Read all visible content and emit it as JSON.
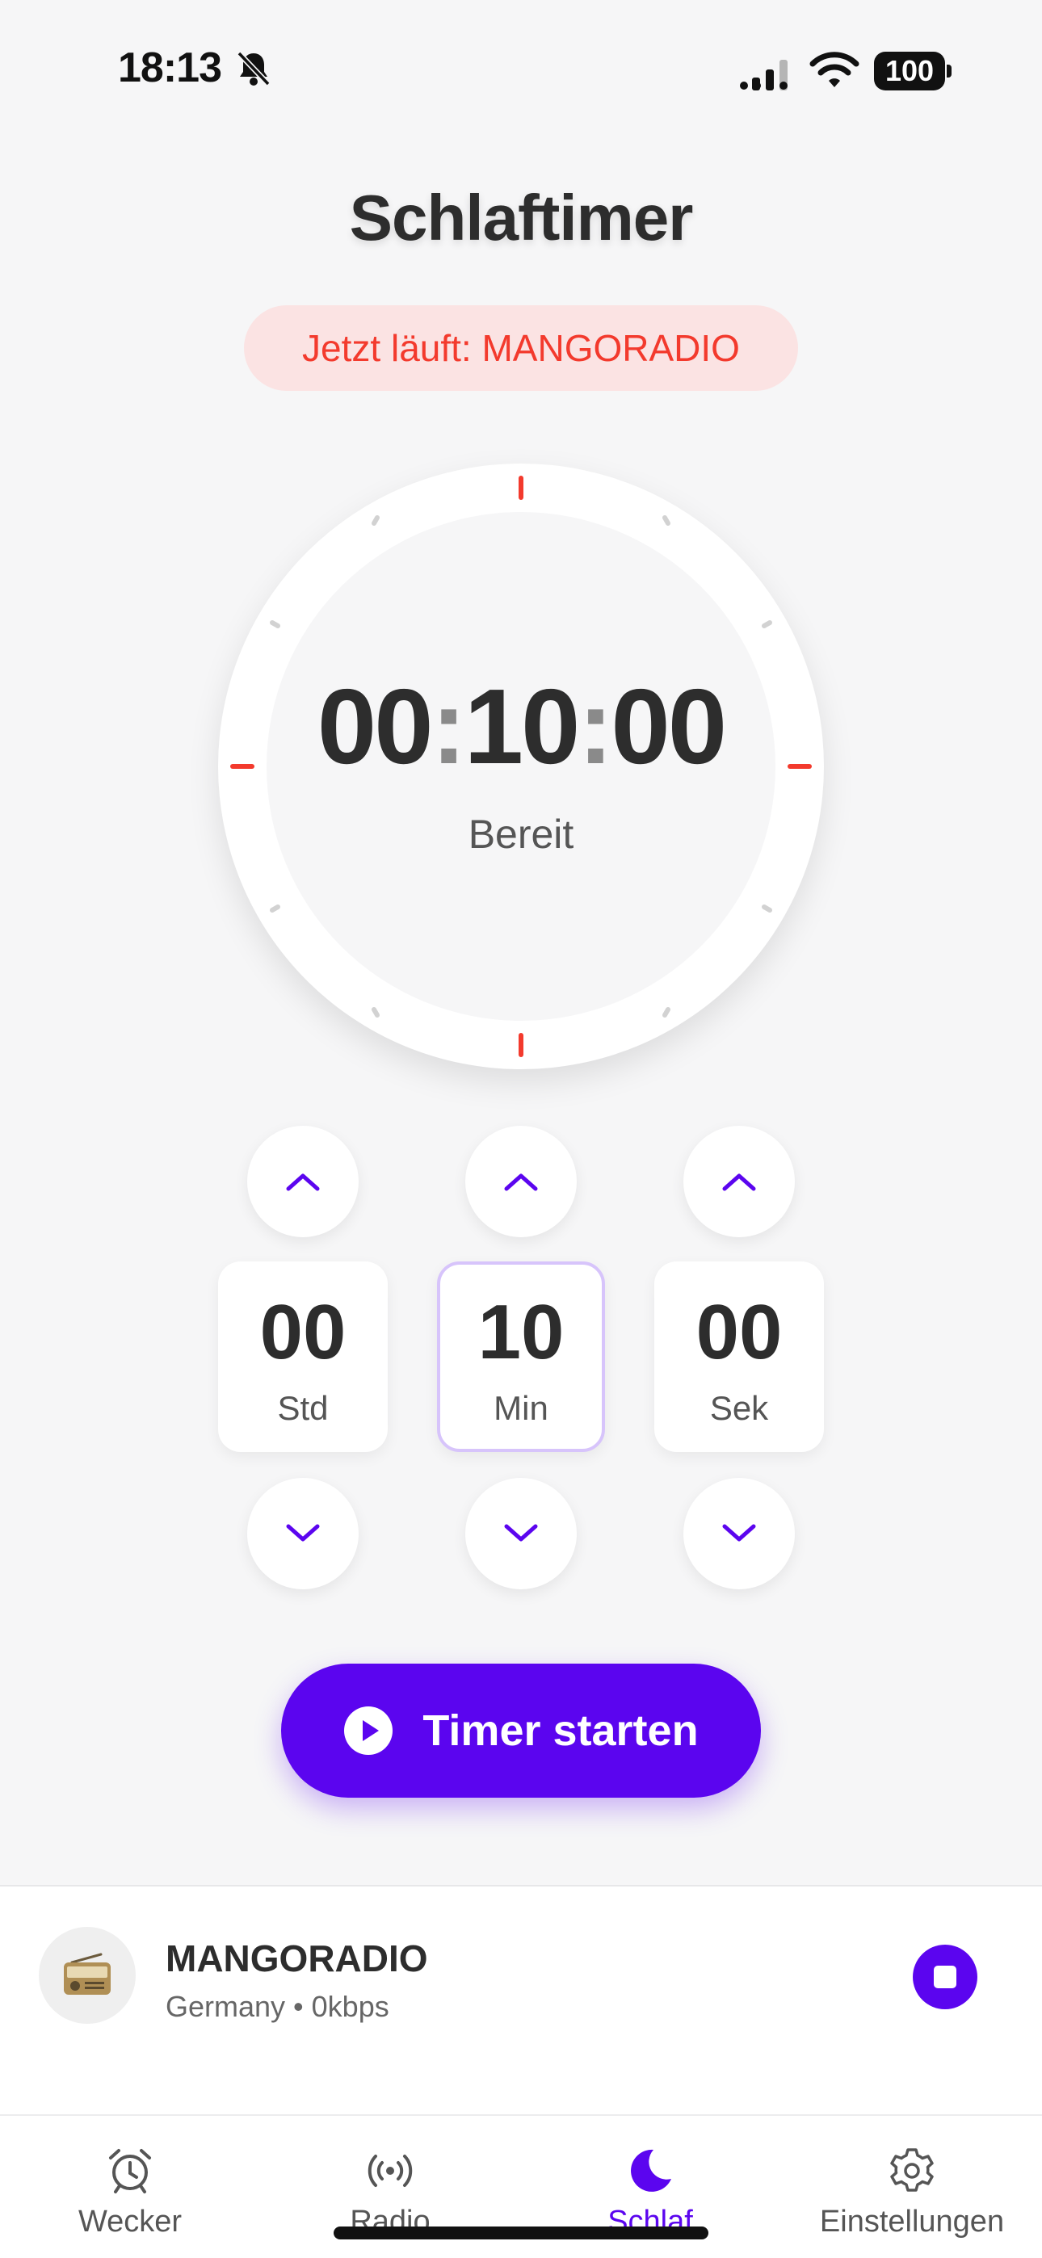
{
  "status_bar": {
    "time": "18:13",
    "battery": "100",
    "icons": [
      "bell-slash-icon",
      "cellular-signal-icon",
      "wifi-icon",
      "battery-icon"
    ]
  },
  "header": {
    "title": "Schlaftimer"
  },
  "now_playing": {
    "text": "Jetzt läuft: MANGORADIO"
  },
  "dial": {
    "hours": "00",
    "minutes": "10",
    "seconds": "00",
    "separator": ":",
    "state": "Bereit"
  },
  "units": [
    {
      "value": "00",
      "label": "Std",
      "selected": false
    },
    {
      "value": "10",
      "label": "Min",
      "selected": true
    },
    {
      "value": "00",
      "label": "Sek",
      "selected": false
    }
  ],
  "start_button": {
    "label": "Timer starten",
    "icon": "play-icon"
  },
  "mini_player": {
    "station": "MANGORADIO",
    "subtitle": "Germany • 0kbps",
    "avatar_icon": "radio-icon",
    "stop_icon": "stop-icon"
  },
  "tabs": [
    {
      "label": "Wecker",
      "icon": "alarm-clock-icon",
      "active": false
    },
    {
      "label": "Radio",
      "icon": "broadcast-icon",
      "active": false
    },
    {
      "label": "Schlaf",
      "icon": "moon-icon",
      "active": true
    },
    {
      "label": "Einstellungen",
      "icon": "gear-icon",
      "active": false
    }
  ],
  "colors": {
    "accent": "#5b05ef",
    "alert": "#f33a2d",
    "pill_background": "#fbe3e3",
    "background": "#f6f6f7"
  }
}
